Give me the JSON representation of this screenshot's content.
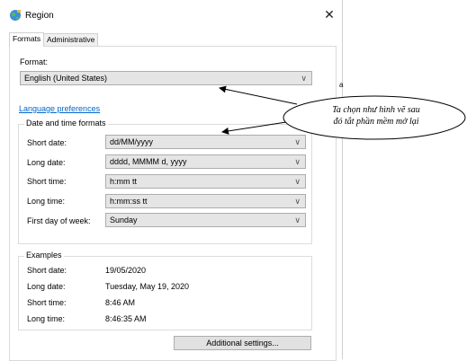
{
  "window": {
    "title": "Region",
    "close_glyph": "✕",
    "icon": "globe-region-icon"
  },
  "tabs": [
    {
      "label": "Formats",
      "active": true
    },
    {
      "label": "Administrative",
      "active": false
    }
  ],
  "format": {
    "label": "Format:",
    "value": "English (United States)"
  },
  "language_link": "Language preferences",
  "date_time": {
    "title": "Date and time formats",
    "rows": [
      {
        "label": "Short date:",
        "value": "dd/MM/yyyy"
      },
      {
        "label": "Long date:",
        "value": "dddd, MMMM d, yyyy"
      },
      {
        "label": "Short time:",
        "value": "h:mm tt"
      },
      {
        "label": "Long time:",
        "value": "h:mm:ss tt"
      },
      {
        "label": "First day of week:",
        "value": "Sunday"
      }
    ]
  },
  "examples": {
    "title": "Examples",
    "rows": [
      {
        "label": "Short date:",
        "value": "19/05/2020"
      },
      {
        "label": "Long date:",
        "value": "Tuesday, May 19, 2020"
      },
      {
        "label": "Short time:",
        "value": "8:46 AM"
      },
      {
        "label": "Long time:",
        "value": "8:46:35 AM"
      }
    ]
  },
  "additional_button": "Additional settings...",
  "annotation": {
    "line1": "Ta chọn như hình vẽ sau",
    "line2": "đó tắt phần mềm mở lại"
  },
  "side_fragment": "a"
}
